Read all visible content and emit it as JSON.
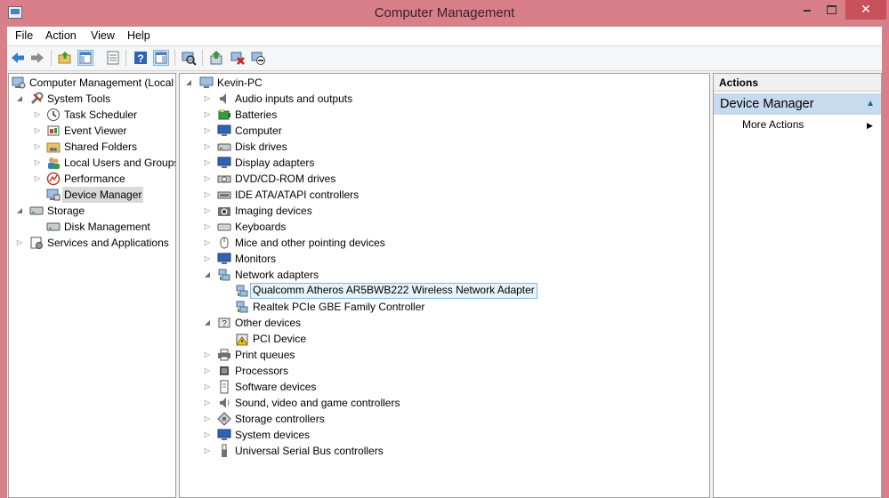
{
  "window": {
    "title": "Computer Management",
    "minimize_glyph": "",
    "close_glyph": "✕",
    "colors": {
      "frame": "#d97f8a",
      "close": "#c7505b",
      "selection": "#c6dbef"
    }
  },
  "menu": [
    "File",
    "Action",
    "View",
    "Help"
  ],
  "toolbar_icons": [
    "back-icon",
    "forward-icon",
    "up-folder-icon",
    "show-hide-console-tree-icon",
    "properties-icon",
    "help-icon",
    "show-hide-action-pane-icon",
    "scan-hardware-icon",
    "update-driver-icon",
    "uninstall-device-icon",
    "disable-device-icon"
  ],
  "tree": {
    "root": "Computer Management (Local",
    "system_tools": "System Tools",
    "task_scheduler": "Task Scheduler",
    "event_viewer": "Event Viewer",
    "shared_folders": "Shared Folders",
    "local_users": "Local Users and Groups",
    "performance": "Performance",
    "device_manager": "Device Manager",
    "storage": "Storage",
    "disk_management": "Disk Management",
    "services_apps": "Services and Applications"
  },
  "devices": {
    "computer_name": "Kevin-PC",
    "categories": [
      "Audio inputs and outputs",
      "Batteries",
      "Computer",
      "Disk drives",
      "Display adapters",
      "DVD/CD-ROM drives",
      "IDE ATA/ATAPI controllers",
      "Imaging devices",
      "Keyboards",
      "Mice and other pointing devices",
      "Monitors",
      "Network adapters",
      "Qualcomm Atheros AR5BWB222 Wireless Network Adapter",
      "Realtek PCIe GBE Family Controller",
      "Other devices",
      "PCI Device",
      "Print queues",
      "Processors",
      "Software devices",
      "Sound, video and game controllers",
      "Storage controllers",
      "System devices",
      "Universal Serial Bus controllers"
    ]
  },
  "actions": {
    "header": "Actions",
    "section": "Device Manager",
    "more": "More Actions"
  }
}
